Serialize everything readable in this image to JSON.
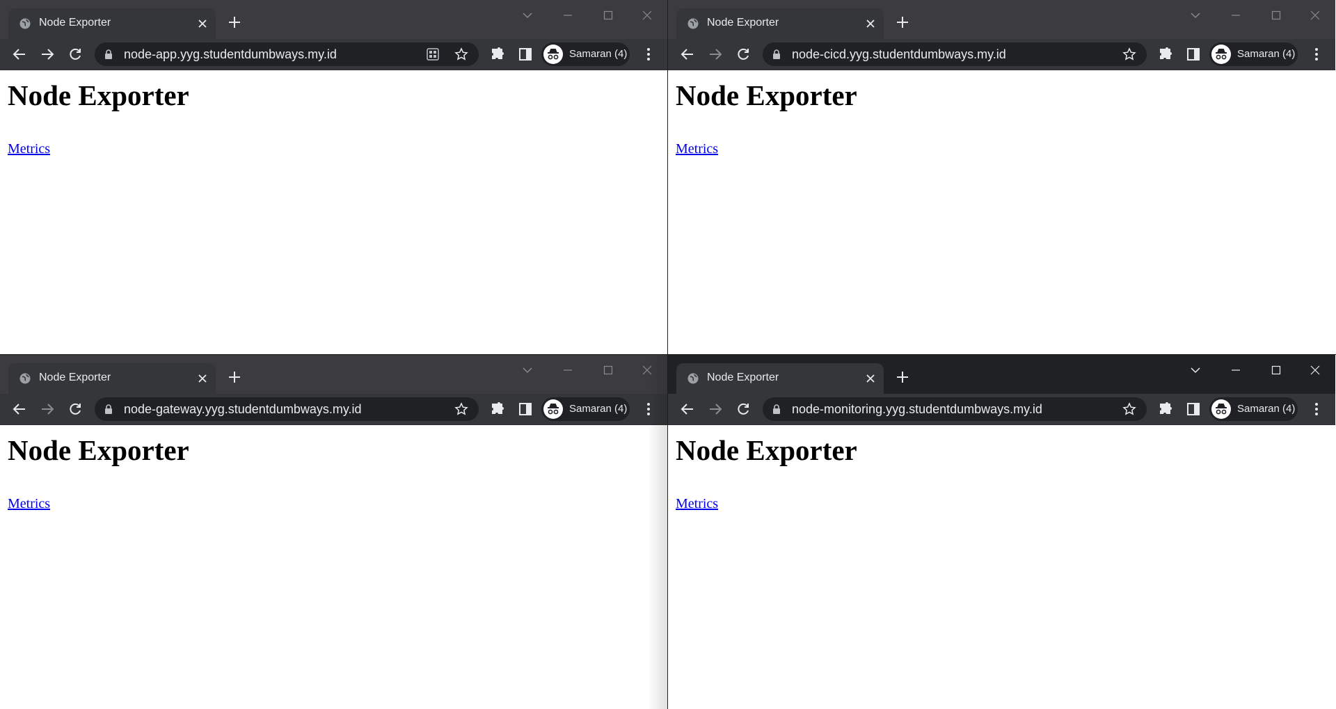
{
  "windows": [
    {
      "id": "tl",
      "active": false,
      "tab_title": "Node Exporter",
      "url": "node-app.yyg.studentdumbways.my.id",
      "show_qr": true,
      "profile_label": "Samaran (4)",
      "page": {
        "heading": "Node Exporter",
        "link": "Metrics"
      }
    },
    {
      "id": "tr",
      "active": false,
      "tab_title": "Node Exporter",
      "url": "node-cicd.yyg.studentdumbways.my.id",
      "show_qr": false,
      "profile_label": "Samaran (4)",
      "page": {
        "heading": "Node Exporter",
        "link": "Metrics"
      }
    },
    {
      "id": "bl",
      "active": false,
      "tab_title": "Node Exporter",
      "url": "node-gateway.yyg.studentdumbways.my.id",
      "show_qr": false,
      "profile_label": "Samaran (4)",
      "page": {
        "heading": "Node Exporter",
        "link": "Metrics"
      }
    },
    {
      "id": "br",
      "active": true,
      "tab_title": "Node Exporter",
      "url": "node-monitoring.yyg.studentdumbways.my.id",
      "show_qr": false,
      "profile_label": "Samaran (4)",
      "page": {
        "heading": "Node Exporter",
        "link": "Metrics"
      }
    }
  ],
  "colors": {
    "inactive_frame": "#3c3c3e",
    "active_frame": "#202124",
    "toolbar": "#35363a",
    "omnibox": "#202124",
    "link": "#0000ee"
  },
  "icons": {
    "favicon": "globe-icon",
    "tab_close": "close-icon",
    "new_tab": "plus-icon",
    "tab_search": "chevron-down-icon",
    "minimize": "minimize-icon",
    "maximize": "maximize-icon",
    "window_close": "close-icon",
    "back": "arrow-left-icon",
    "forward": "arrow-right-icon",
    "reload": "reload-icon",
    "lock": "lock-icon",
    "qr": "qr-code-icon",
    "bookmark": "star-icon",
    "extensions": "puzzle-icon",
    "side_panel": "side-panel-icon",
    "avatar": "incognito-avatar-icon",
    "menu": "kebab-menu-icon"
  }
}
